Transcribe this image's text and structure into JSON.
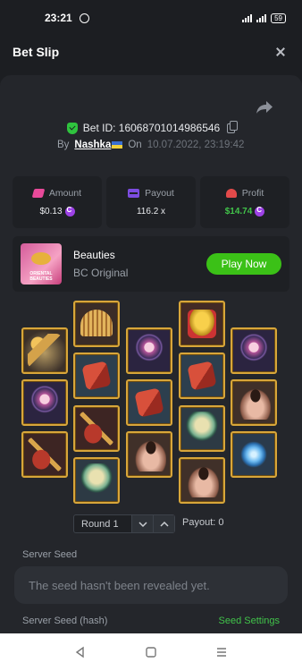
{
  "status_bar": {
    "time": "23:21",
    "battery": "59"
  },
  "header": {
    "title": "Bet Slip"
  },
  "bet": {
    "id_label": "Bet ID: 16068701014986546",
    "by_label": "By",
    "user": "Nashka",
    "on_label": "On",
    "date": "10.07.2022, 23:19:42"
  },
  "stats": {
    "amount": {
      "label": "Amount",
      "value": "$0.13"
    },
    "payout": {
      "label": "Payout",
      "value": "116.2 x"
    },
    "profit": {
      "label": "Profit",
      "value": "$14.74"
    }
  },
  "game": {
    "name": "Beauties",
    "provider": "BC Original",
    "play_label": "Play Now",
    "thumb_text": "ORIENTAL BEAUTIES"
  },
  "reels": [
    [
      "hairpin",
      "mirror",
      "pipa"
    ],
    [
      "comb",
      "book",
      "pipa",
      "jade"
    ],
    [
      "mirror",
      "book",
      "lady"
    ],
    [
      "gold",
      "book",
      "jade",
      "lady"
    ],
    [
      "mirror",
      "lady",
      "lotus"
    ]
  ],
  "round": {
    "label": "Round 1",
    "payout_label": "Payout: 0"
  },
  "seeds": {
    "server_seed_label": "Server Seed",
    "server_seed_placeholder": "The seed hasn't been revealed yet.",
    "hash_label": "Server Seed (hash)",
    "settings_label": "Seed Settings"
  },
  "colors": {
    "accent_green": "#3bc117",
    "background": "#1c1e22",
    "panel": "#24262b",
    "tile_border": "#d8a63a"
  }
}
